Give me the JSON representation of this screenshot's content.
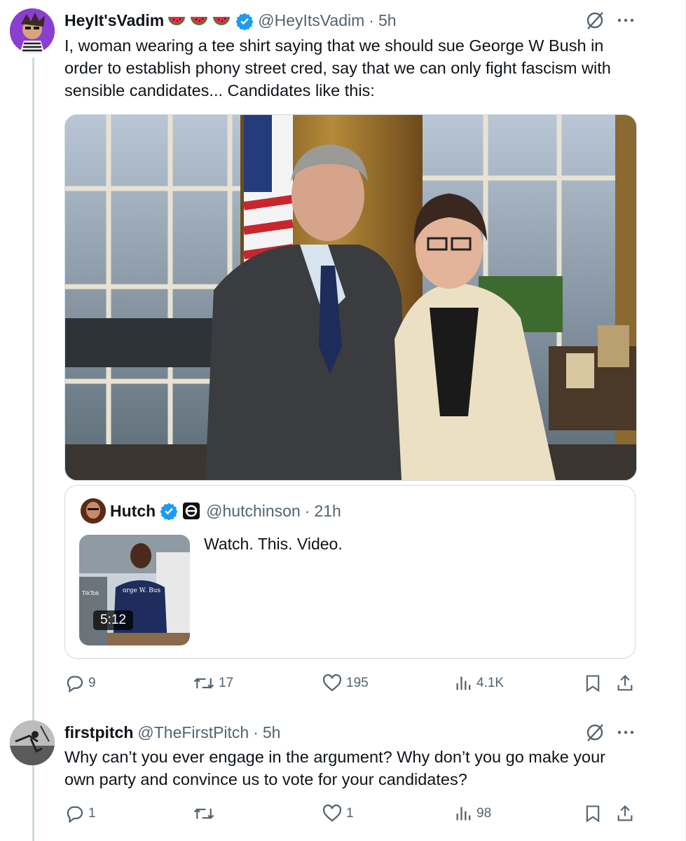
{
  "tweet1": {
    "name": "HeyIt'sVadim",
    "handle": "@HeyItsVadim",
    "separator": "·",
    "time": "5h",
    "text_line1": "I, woman wearing a tee shirt saying that we should sue George W Bush in",
    "text_line2": "order to establish phony street cred, say that we can only fight fascism with",
    "text_line3": "sensible candidates... Candidates like this:",
    "quote": {
      "name": "Hutch",
      "handle": "@hutchinson",
      "separator": "·",
      "time": "21h",
      "text": "Watch. This. Video.",
      "video_duration": "5:12",
      "thumb_caption": "orge W. Bus",
      "thumb_brand": "TikTok"
    },
    "stats": {
      "replies": "9",
      "reposts": "17",
      "likes": "195",
      "views": "4.1K"
    }
  },
  "tweet2": {
    "name": "firstpitch",
    "handle": "@TheFirstPitch",
    "separator": "·",
    "time": "5h",
    "text_line1": "Why can’t you ever engage in the argument? Why don’t you go make your",
    "text_line2": "own party and convince us to vote for your candidates?",
    "stats": {
      "replies": "1",
      "reposts": "",
      "likes": "1",
      "views": "98"
    }
  },
  "colors": {
    "verified": "#1d9bf0",
    "secondary_text": "#536471",
    "border": "#cfd9de",
    "watermelon_red": "#e0304a",
    "watermelon_green": "#2e8b3a"
  },
  "icons": [
    "reply-icon",
    "repost-icon",
    "like-icon",
    "views-icon",
    "bookmark-icon",
    "share-icon",
    "grok-icon",
    "more-icon",
    "verified-icon",
    "watermelon-icon"
  ]
}
